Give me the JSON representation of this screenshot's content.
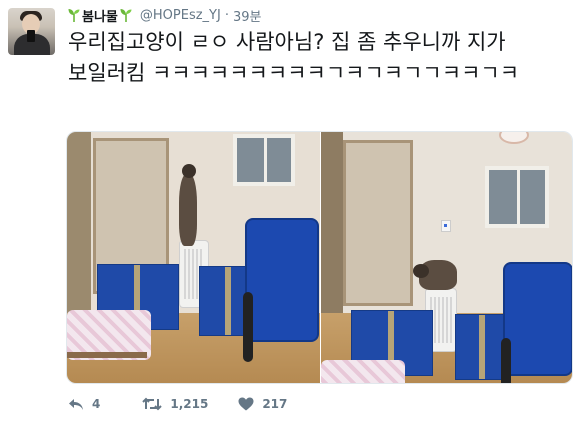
{
  "tweet": {
    "display_name": "봄나물",
    "handle": "@HOPEsz_YJ",
    "separator": "·",
    "time": "39분",
    "text": "우리집고양이 ㄹㅇ 사람아님? 집 좀 추우니까 지가 보일러킴 ㅋㅋㅋㅋㅋㅋㅋㅋㅋㄱㅋㄱㅋㄱㄱㅋㅋㄱㅋ",
    "media": [
      {
        "alt": "cat standing on humidifier reaching boiler panel"
      },
      {
        "alt": "cat crouching on humidifier"
      }
    ],
    "actions": {
      "reply_count": "4",
      "retweet_count": "1,215",
      "like_count": "217"
    }
  },
  "icons": {
    "sprout": "sprout-icon",
    "reply": "reply-icon",
    "retweet": "retweet-icon",
    "like": "heart-icon"
  },
  "colors": {
    "text_primary": "#14171a",
    "text_secondary": "#657786",
    "sprout_green": "#6bb83a"
  }
}
